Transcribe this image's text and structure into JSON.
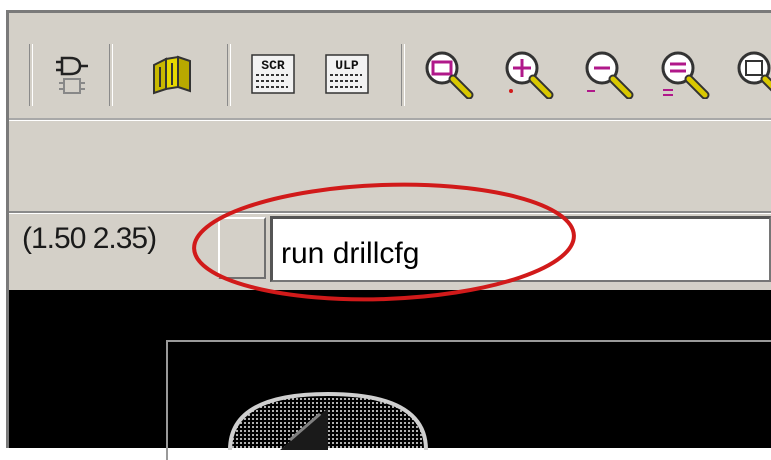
{
  "toolbar": {
    "buttons": [
      {
        "icon": "logic-gate-symbol-icon"
      },
      {
        "icon": "book-library-icon"
      },
      {
        "icon": "script-scr-icon",
        "label": "SCR"
      },
      {
        "icon": "ulp-icon",
        "label": "ULP"
      },
      {
        "icon": "zoom-fit-icon"
      },
      {
        "icon": "zoom-in-icon"
      },
      {
        "icon": "zoom-out-icon"
      },
      {
        "icon": "zoom-redraw-icon"
      },
      {
        "icon": "zoom-select-icon"
      }
    ]
  },
  "command_line": {
    "coordinates": "(1.50 2.35)",
    "value": "run drillcfg"
  },
  "colors": {
    "highlight_ellipse": "#d11a1a",
    "canvas_background": "#000000",
    "toolbar_background": "#d4d0c8"
  }
}
